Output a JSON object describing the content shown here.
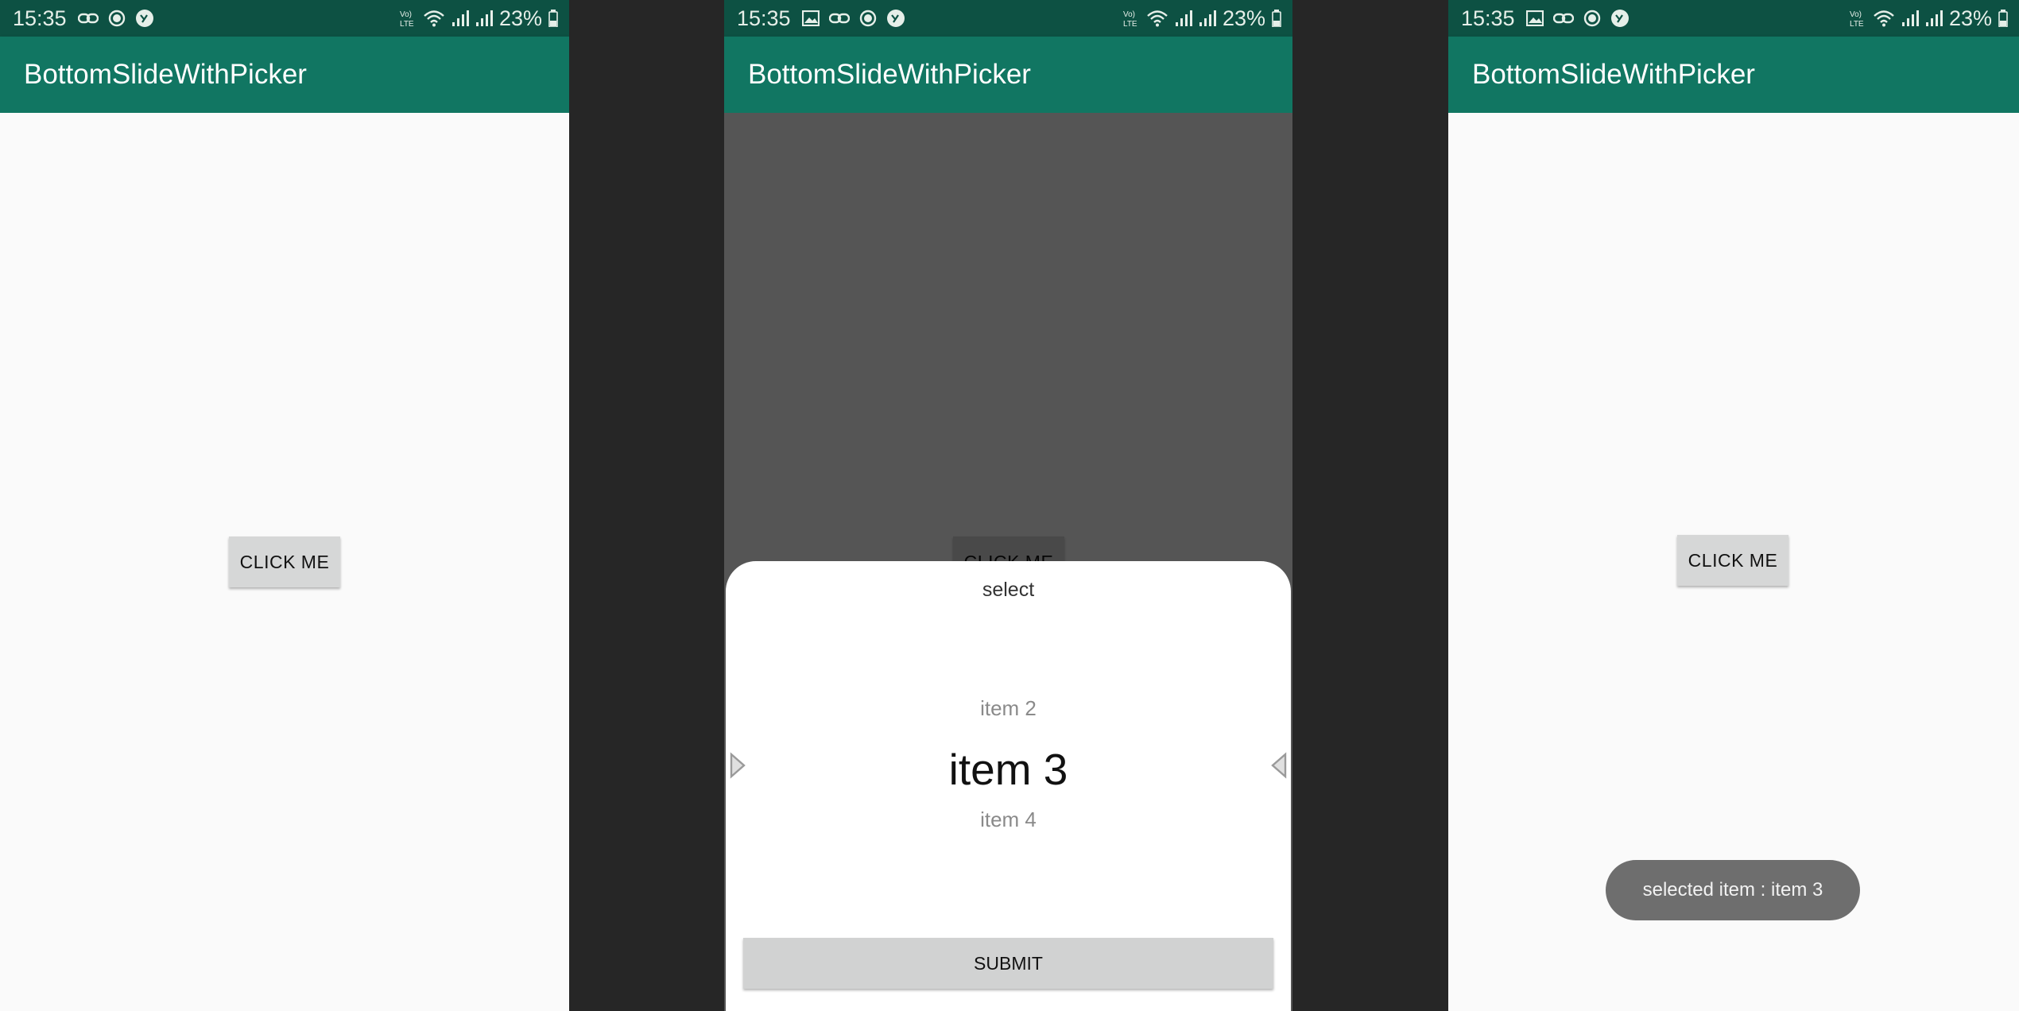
{
  "status_bar": {
    "time": "15:35",
    "battery": "23%",
    "network": "VoLTE"
  },
  "app": {
    "title": "BottomSlideWithPicker"
  },
  "main": {
    "button_label": "CLICK ME"
  },
  "sheet": {
    "title": "select",
    "items": [
      "item 2",
      "item 3",
      "item 4"
    ],
    "selected": "item 3",
    "submit_label": "SUBMIT"
  },
  "toast": {
    "message": "selected item : item 3"
  },
  "colors": {
    "status_bar": "#0d5143",
    "app_bar": "#117662",
    "background": "#fafafa",
    "button": "#d6d7d7",
    "toast": "#6e6e6e"
  }
}
